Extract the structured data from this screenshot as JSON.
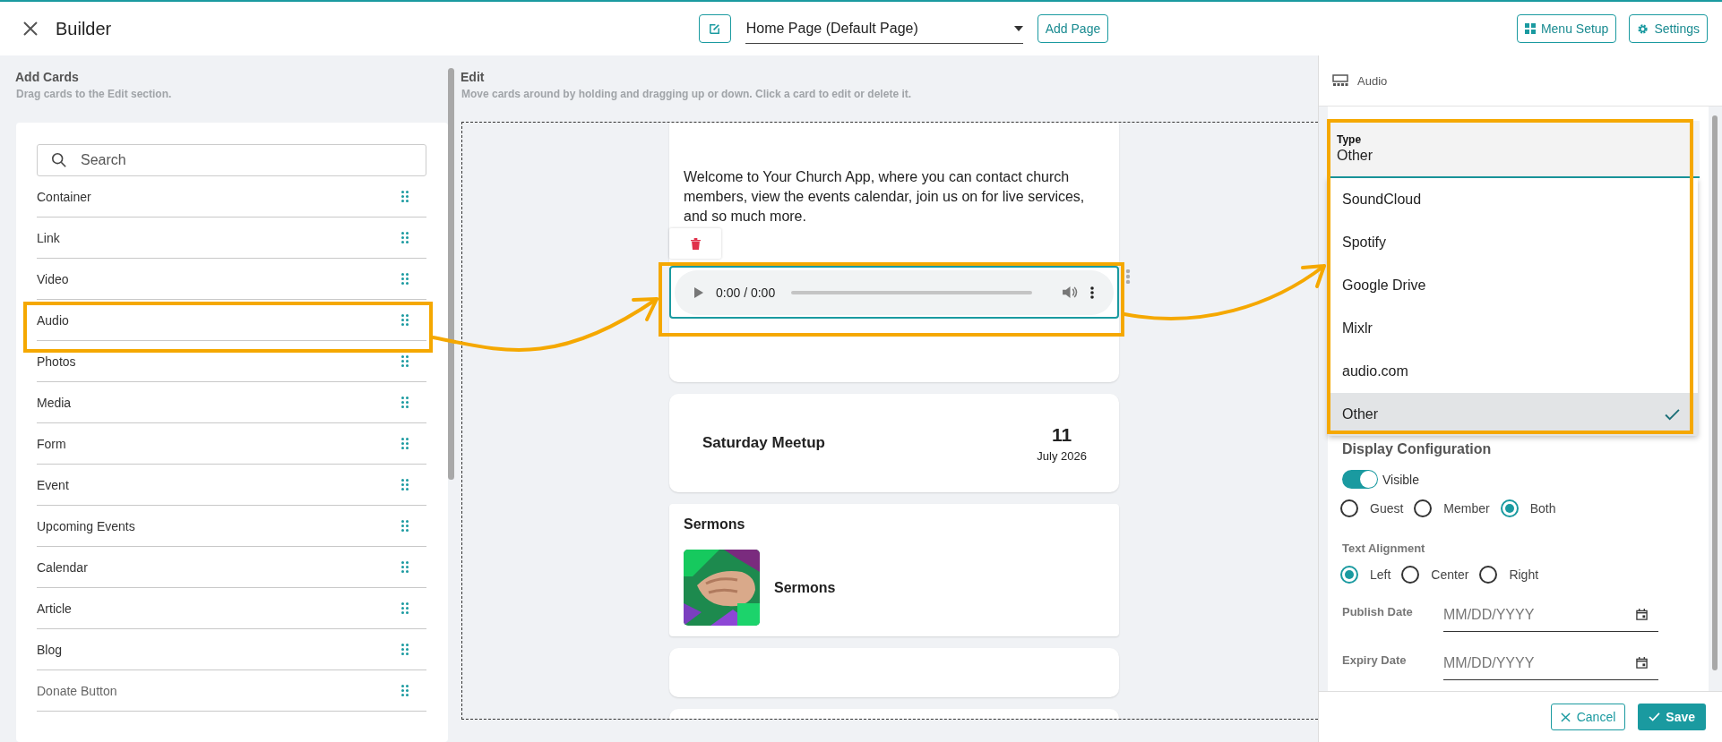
{
  "header": {
    "title": "Builder",
    "page_select": "Home Page (Default Page)",
    "add_page": "Add Page",
    "menu_setup": "Menu Setup",
    "settings": "Settings"
  },
  "add_cards": {
    "title": "Add Cards",
    "hint": "Drag cards to the Edit section.",
    "search": {
      "placeholder": "Search"
    },
    "items": [
      "Container",
      "Link",
      "Video",
      "Audio",
      "Photos",
      "Media",
      "Form",
      "Event",
      "Upcoming Events",
      "Calendar",
      "Article",
      "Blog",
      "Donate Button"
    ]
  },
  "edit": {
    "title": "Edit",
    "hint": "Move cards around by holding and dragging up or down. Click a card to edit or delete it.",
    "cards": [
      {
        "kind": "text_audio",
        "text": "Welcome to Your Church App, where you can contact church members, view the events calendar, join us on for live services, and so much more.",
        "time": "0:00 / 0:00"
      },
      {
        "kind": "event",
        "title": "Saturday Meetup",
        "day": "11",
        "month": "July 2026"
      },
      {
        "kind": "sermons",
        "title": "Sermons",
        "item": "Sermons"
      },
      {
        "kind": "blank"
      },
      {
        "kind": "blank"
      }
    ]
  },
  "panel": {
    "title": "Audio",
    "type": {
      "label": "Type",
      "value": "Other",
      "options": [
        {
          "label": "SoundCloud",
          "selected": false
        },
        {
          "label": "Spotify",
          "selected": false
        },
        {
          "label": "Google Drive",
          "selected": false
        },
        {
          "label": "Mixlr",
          "selected": false
        },
        {
          "label": "audio.com",
          "selected": false
        },
        {
          "label": "Other",
          "selected": true
        }
      ]
    },
    "display_title": "Display Configuration",
    "visible": {
      "label": "Visible",
      "on": true
    },
    "audience": [
      {
        "label": "Guest",
        "selected": false
      },
      {
        "label": "Member",
        "selected": false
      },
      {
        "label": "Both",
        "selected": true
      }
    ],
    "alignment_title": "Text Alignment",
    "alignment": [
      {
        "label": "Left",
        "selected": true
      },
      {
        "label": "Center",
        "selected": false
      },
      {
        "label": "Right",
        "selected": false
      }
    ],
    "dates": [
      {
        "label": "Publish Date",
        "placeholder": "MM/DD/YYYY"
      },
      {
        "label": "Expiry Date",
        "placeholder": "MM/DD/YYYY"
      }
    ],
    "cancel": "Cancel",
    "save": "Save"
  }
}
